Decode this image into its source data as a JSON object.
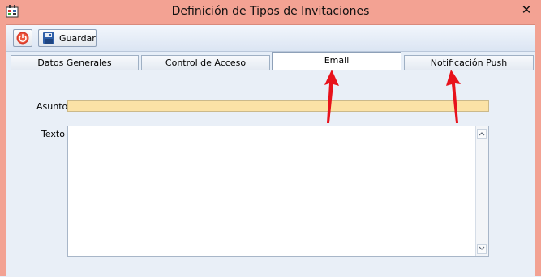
{
  "window": {
    "title": "Definición de Tipos de Invitaciones",
    "close_symbol": "✕"
  },
  "toolbar": {
    "exit_icon": "power-icon",
    "save_label": "Guardar",
    "save_icon": "floppy-disk-icon"
  },
  "tabs": [
    {
      "label": "Datos Generales",
      "active": false
    },
    {
      "label": "Control de Acceso",
      "active": false
    },
    {
      "label": "Email",
      "active": true
    },
    {
      "label": "Notificación Push",
      "active": false
    }
  ],
  "form": {
    "asunto_label": "Asunto",
    "asunto_value": "",
    "texto_label": "Texto",
    "texto_value": ""
  },
  "annotation_color": "#e8121b",
  "accent_colors": {
    "titlebar": "#f3a293",
    "input_highlight": "#fbe2a6"
  }
}
